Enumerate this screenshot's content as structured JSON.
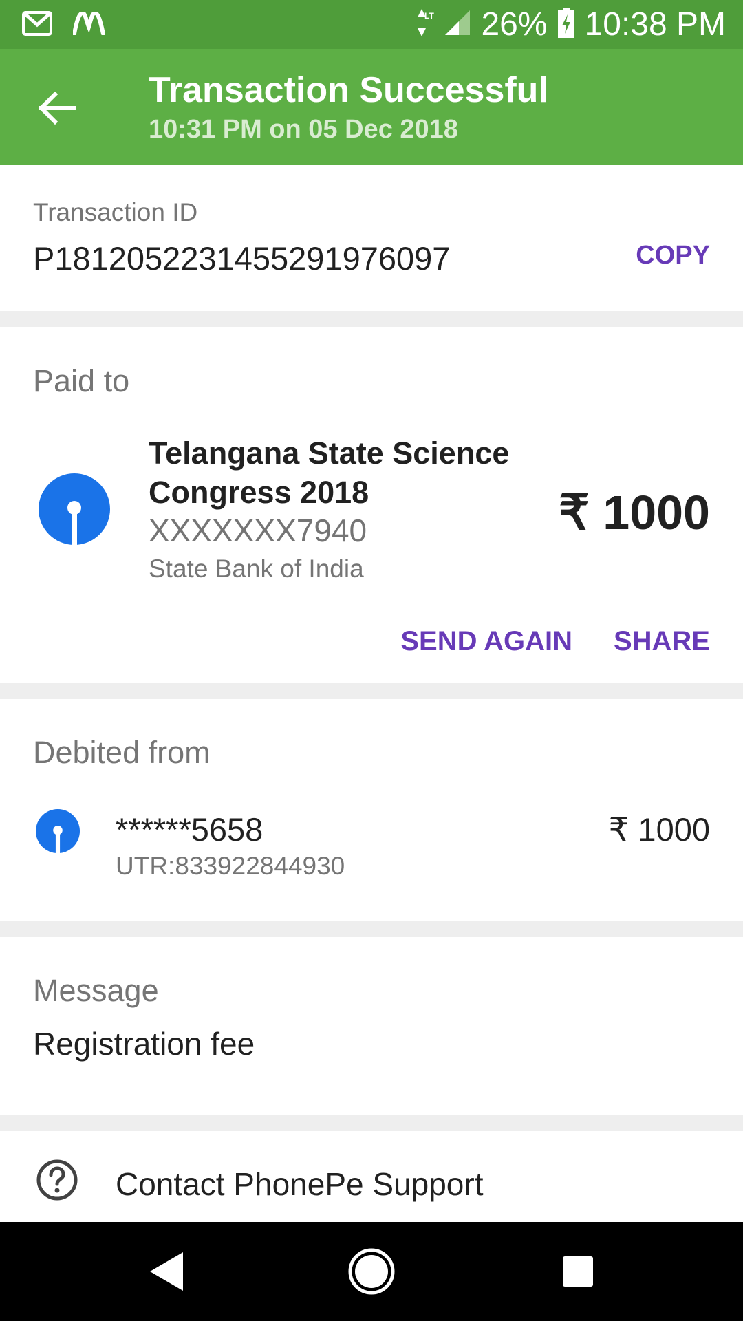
{
  "status_bar": {
    "battery": "26%",
    "time": "10:38 PM",
    "network_label": "LTE",
    "icons": [
      "gmail-icon",
      "m-app-icon",
      "data-arrows-icon",
      "signal-icon",
      "battery-charging-icon"
    ]
  },
  "app_bar": {
    "title": "Transaction Successful",
    "subtitle": "10:31 PM on 05 Dec 2018",
    "color": "#5daf45"
  },
  "transaction": {
    "id_label": "Transaction ID",
    "id_value": "P1812052231455291976097",
    "copy_label": "COPY"
  },
  "paid_to": {
    "label": "Paid to",
    "name": "Telangana State Science Congress 2018",
    "account": "XXXXXXX7940",
    "bank": "State Bank of India",
    "amount": "₹ 1000",
    "send_again_label": "SEND AGAIN",
    "share_label": "SHARE"
  },
  "debited_from": {
    "label": "Debited from",
    "account": "******5658",
    "utr": "UTR:833922844930",
    "amount": "₹ 1000"
  },
  "message": {
    "label": "Message",
    "value": "Registration fee"
  },
  "support": {
    "label": "Contact PhonePe Support"
  },
  "colors": {
    "accent": "#673ab7",
    "sbi_blue": "#1a73e8",
    "divider": "#eeeeee"
  }
}
